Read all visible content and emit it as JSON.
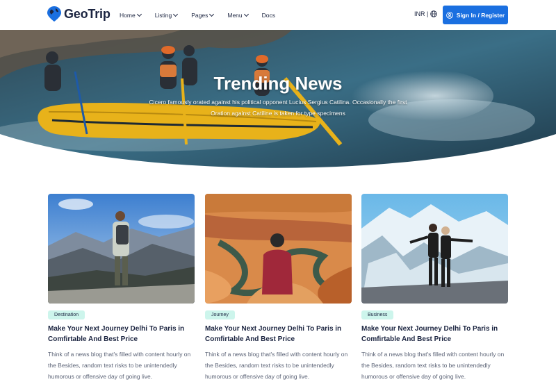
{
  "brand": {
    "name": "GeoTrip"
  },
  "nav": {
    "items": [
      {
        "label": "Home",
        "has_dropdown": true
      },
      {
        "label": "Listing",
        "has_dropdown": true
      },
      {
        "label": "Pages",
        "has_dropdown": true
      },
      {
        "label": "Menu",
        "has_dropdown": true
      },
      {
        "label": "Docs",
        "has_dropdown": false
      }
    ],
    "currency": "INR |",
    "signin_label": "Sign In / Register"
  },
  "hero": {
    "title": "Trending News",
    "subtitle": "Cicero famously orated against his political opponent Lucius Sergius Catilina. Occasionally the first Oration against Catiline is taken for type specimens"
  },
  "cards": [
    {
      "category": "Destination",
      "title": "Make Your Next Journey Delhi To Paris in Comfirtable And Best Price",
      "text": "Think of a news blog that's filled with content hourly on the Besides, random text risks to be unintendedly humorous or offensive day of going live."
    },
    {
      "category": "Journey",
      "title": "Make Your Next Journey Delhi To Paris in Comfirtable And Best Price",
      "text": "Think of a news blog that's filled with content hourly on the Besides, random text risks to be unintendedly humorous or offensive day of going live."
    },
    {
      "category": "Business",
      "title": "Make Your Next Journey Delhi To Paris in Comfirtable And Best Price",
      "text": "Think of a news blog that's filled with content hourly on the Besides, random text risks to be unintendedly humorous or offensive day of going live."
    }
  ],
  "colors": {
    "primary": "#1a6fe0",
    "heading": "#1b2440",
    "badge_bg": "#cdf5ec"
  },
  "icons": {
    "logo": "globe-pin-icon",
    "currency": "globe-icon",
    "signin": "user-icon",
    "dropdown": "chevron-down-icon"
  }
}
